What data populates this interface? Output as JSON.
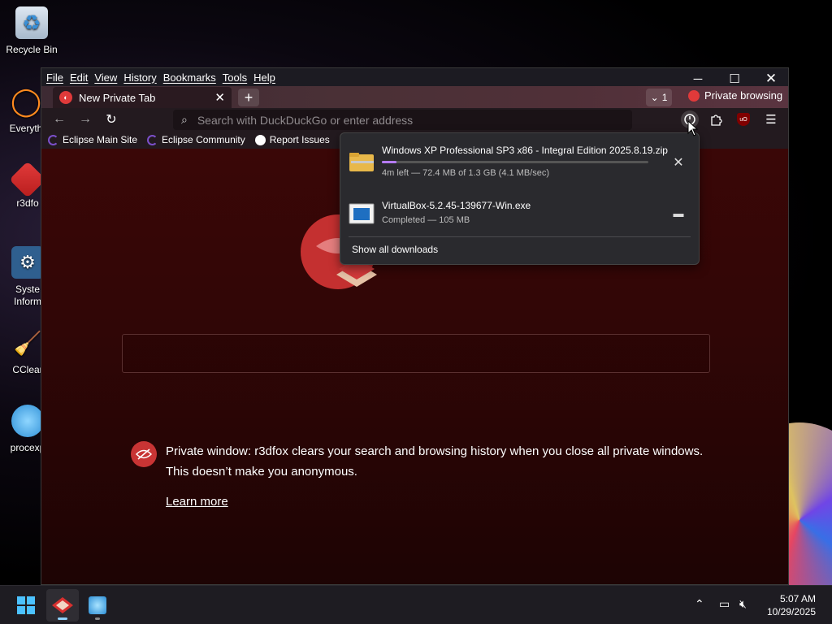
{
  "desktop": {
    "icons": [
      {
        "label": "Recycle Bin"
      },
      {
        "label": "Everyth"
      },
      {
        "label": "r3dfo"
      },
      {
        "label": "Syste Inform"
      },
      {
        "label": "CClear"
      },
      {
        "label": "procexp"
      }
    ]
  },
  "browser": {
    "menubar": [
      "File",
      "Edit",
      "View",
      "History",
      "Bookmarks",
      "Tools",
      "Help"
    ],
    "tab": {
      "title": "New Private Tab"
    },
    "tab_list_count": "1",
    "private_label": "Private browsing",
    "urlbar": {
      "placeholder": "Search with DuckDuckGo or enter address"
    },
    "bookmarks": [
      "Eclipse Main Site",
      "Eclipse Community",
      "Report Issues"
    ],
    "private_notice": {
      "text": "Private window: r3dfox clears your search and browsing history when you close all private windows. This doesn’t make you anonymous.",
      "learn_more": "Learn more"
    }
  },
  "downloads": {
    "items": [
      {
        "name": "Windows XP Professional SP3 x86 - Integral Edition 2025.8.19.zip",
        "status": "4m left — 72.4 MB of 1.3 GB (4.1 MB/sec)",
        "progress": 0.054,
        "action": "cancel"
      },
      {
        "name": "VirtualBox-5.2.45-139677-Win.exe",
        "status": "Completed — 105 MB",
        "action": "open-folder"
      }
    ],
    "show_all": "Show all downloads"
  },
  "taskbar": {
    "time": "5:07 AM",
    "date": "10/29/2025"
  },
  "colors": {
    "accent_private": "#c83434",
    "progress": "#b57bff"
  }
}
